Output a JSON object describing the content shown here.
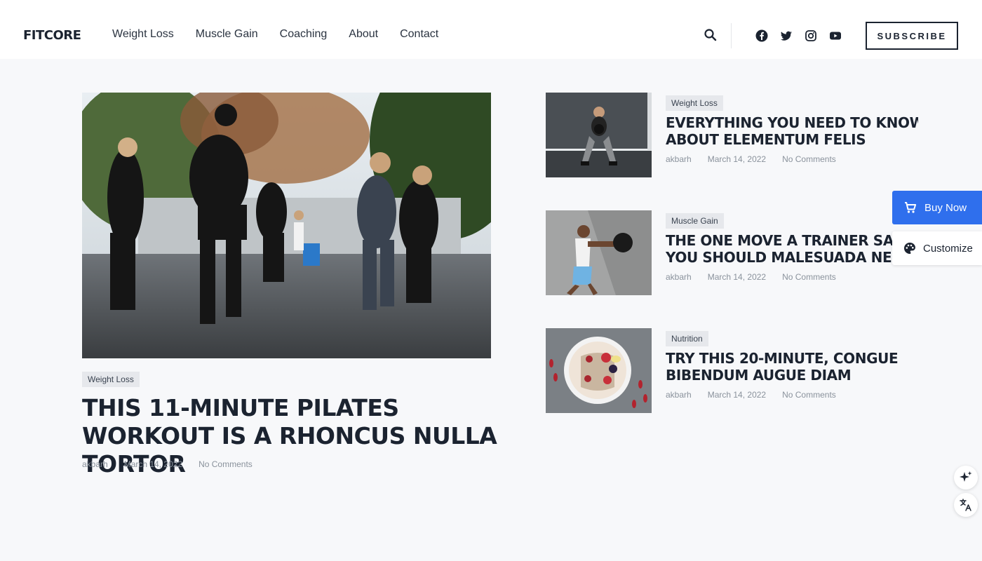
{
  "brand": {
    "logo": "FITCORE"
  },
  "nav": {
    "items": [
      {
        "label": "Weight Loss"
      },
      {
        "label": "Muscle Gain"
      },
      {
        "label": "Coaching"
      },
      {
        "label": "About"
      },
      {
        "label": "Contact"
      }
    ]
  },
  "header": {
    "subscribe_label": "SUBSCRIBE",
    "social_icons": [
      "facebook-icon",
      "twitter-icon",
      "instagram-icon",
      "youtube-icon"
    ]
  },
  "featured": {
    "tag": "Weight Loss",
    "title": "THIS 11-MINUTE PILATES WORKOUT IS A RHONCUS NULLA TORTOR",
    "author": "akbarh",
    "date": "March 14, 2022",
    "comments": "No Comments"
  },
  "posts": [
    {
      "tag": "Weight Loss",
      "title_line1": "EVERYTHING YOU NEED TO KNOW",
      "title_line2": "ABOUT ELEMENTUM FELIS",
      "author": "akbarh",
      "date": "March 14, 2022",
      "comments": "No Comments"
    },
    {
      "tag": "Muscle Gain",
      "title_line1": "THE ONE MOVE A TRAINER SAYS",
      "title_line2": "YOU SHOULD MALESUADA NEQUE",
      "author": "akbarh",
      "date": "March 14, 2022",
      "comments": "No Comments"
    },
    {
      "tag": "Nutrition",
      "title_line1": "TRY THIS 20-MINUTE, CONGUE",
      "title_line2": "BIBENDUM AUGUE DIAM",
      "author": "akbarh",
      "date": "March 14, 2022",
      "comments": "No Comments"
    }
  ],
  "widgets": {
    "buy_now_label": "Buy Now",
    "customize_label": "Customize",
    "accent_color": "#2f6fed"
  }
}
